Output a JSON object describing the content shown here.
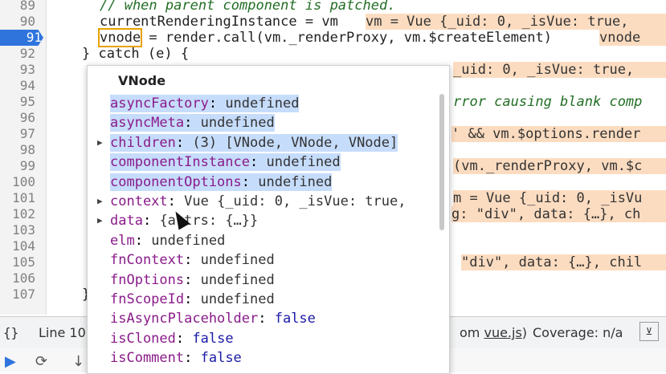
{
  "editor": {
    "lines": [
      {
        "n": "89",
        "text": "// when parent component is patched."
      },
      {
        "n": "90",
        "text": "currentRenderingInstance = vm",
        "inline": "vm = Vue {_uid: 0, _isVue: true,"
      },
      {
        "n": "91",
        "pre": "",
        "boxed": "vnode",
        "post": " = render.call(vm._renderProxy, vm.$createElement)",
        "inline": "vnode"
      },
      {
        "n": "92",
        "text": "} catch (e) {"
      },
      {
        "n": "93",
        "inline": "_uid: 0, _isVue: true,"
      },
      {
        "n": "94",
        "text": ""
      },
      {
        "n": "95",
        "comment": "rror causing blank comp"
      },
      {
        "n": "96",
        "text": ""
      },
      {
        "n": "97",
        "inline": "' && vm.$options.render"
      },
      {
        "n": "98",
        "text": ""
      },
      {
        "n": "99",
        "inline": "(vm._renderProxy, vm.$c"
      },
      {
        "n": "100",
        "text": ""
      },
      {
        "n": "101",
        "inline": "m = Vue {_uid: 0, _isVu"
      },
      {
        "n": "102",
        "inline": "g: \"div\", data: {…}, ch"
      },
      {
        "n": "103",
        "text": ""
      },
      {
        "n": "104",
        "text": ""
      },
      {
        "n": "105",
        "inline": "\"div\", data: {…}, chil"
      },
      {
        "n": "106",
        "text": ""
      },
      {
        "n": "107",
        "text": "}"
      }
    ]
  },
  "popup": {
    "title": "VNode",
    "props": [
      {
        "key": "asyncFactory",
        "value": "undefined",
        "selected": true,
        "expandable": false
      },
      {
        "key": "asyncMeta",
        "value": "undefined",
        "selected": true,
        "expandable": false
      },
      {
        "key": "children",
        "value": "(3) [VNode, VNode, VNode]",
        "selected": true,
        "expandable": true
      },
      {
        "key": "componentInstance",
        "value": "undefined",
        "selected": true,
        "expandable": false
      },
      {
        "key": "componentOptions",
        "value": "undefined",
        "selected": true,
        "expandable": false
      },
      {
        "key": "context",
        "value": "Vue {_uid: 0, _isVue: true,",
        "selected": false,
        "expandable": true
      },
      {
        "key": "data",
        "value": "{attrs: {…}}",
        "selected": false,
        "expandable": true
      },
      {
        "key": "elm",
        "value": "undefined",
        "selected": false,
        "expandable": false
      },
      {
        "key": "fnContext",
        "value": "undefined",
        "selected": false,
        "expandable": false
      },
      {
        "key": "fnOptions",
        "value": "undefined",
        "selected": false,
        "expandable": false
      },
      {
        "key": "fnScopeId",
        "value": "undefined",
        "selected": false,
        "expandable": false
      },
      {
        "key": "isAsyncPlaceholder",
        "value": "false",
        "selected": false,
        "expandable": false
      },
      {
        "key": "isCloned",
        "value": "false",
        "selected": false,
        "expandable": false
      },
      {
        "key": "isComment",
        "value": "false",
        "selected": false,
        "expandable": false
      }
    ]
  },
  "status": {
    "braces": "{}",
    "line": "Line 10",
    "source_link": "vue.js",
    "source_prefix": "om ",
    "source_suffix": ")",
    "coverage": "Coverage: n/a"
  },
  "colors": {
    "active_line": "#2f74dd",
    "inline_value_bg": "#fcdcc0",
    "selection": "#c6dcfb",
    "key": "#8a1b8a"
  }
}
